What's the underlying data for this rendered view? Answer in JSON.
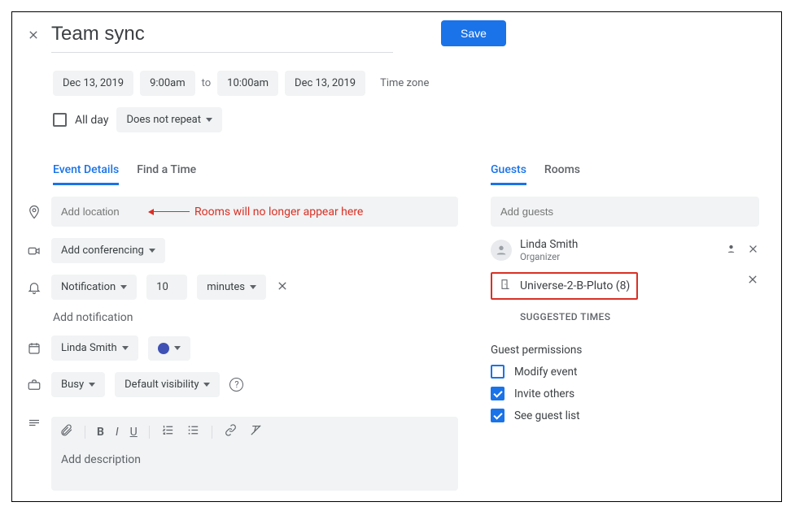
{
  "header": {
    "title": "Team sync",
    "save_label": "Save"
  },
  "time": {
    "start_date": "Dec 13, 2019",
    "start_time": "9:00am",
    "to_label": "to",
    "end_time": "10:00am",
    "end_date": "Dec 13, 2019",
    "timezone_label": "Time zone",
    "all_day_label": "All day",
    "repeat_label": "Does not repeat"
  },
  "tabs_left": {
    "details": "Event Details",
    "find_time": "Find a Time"
  },
  "location": {
    "placeholder": "Add location",
    "annotation": "Rooms will no longer appear here"
  },
  "conferencing_label": "Add conferencing",
  "notification": {
    "type": "Notification",
    "value": "10",
    "unit": "minutes",
    "add_label": "Add notification"
  },
  "calendar_owner": "Linda Smith",
  "availability": {
    "busy": "Busy",
    "visibility": "Default visibility"
  },
  "description_placeholder": "Add description",
  "tabs_right": {
    "guests": "Guests",
    "rooms": "Rooms"
  },
  "guests_input_placeholder": "Add guests",
  "guests": {
    "organizer_name": "Linda Smith",
    "organizer_sub": "Organizer",
    "room_name": "Universe-2-B-Pluto (8)"
  },
  "suggested_label": "Suggested times",
  "permissions": {
    "title": "Guest permissions",
    "modify": "Modify event",
    "invite": "Invite others",
    "see_list": "See guest list"
  }
}
